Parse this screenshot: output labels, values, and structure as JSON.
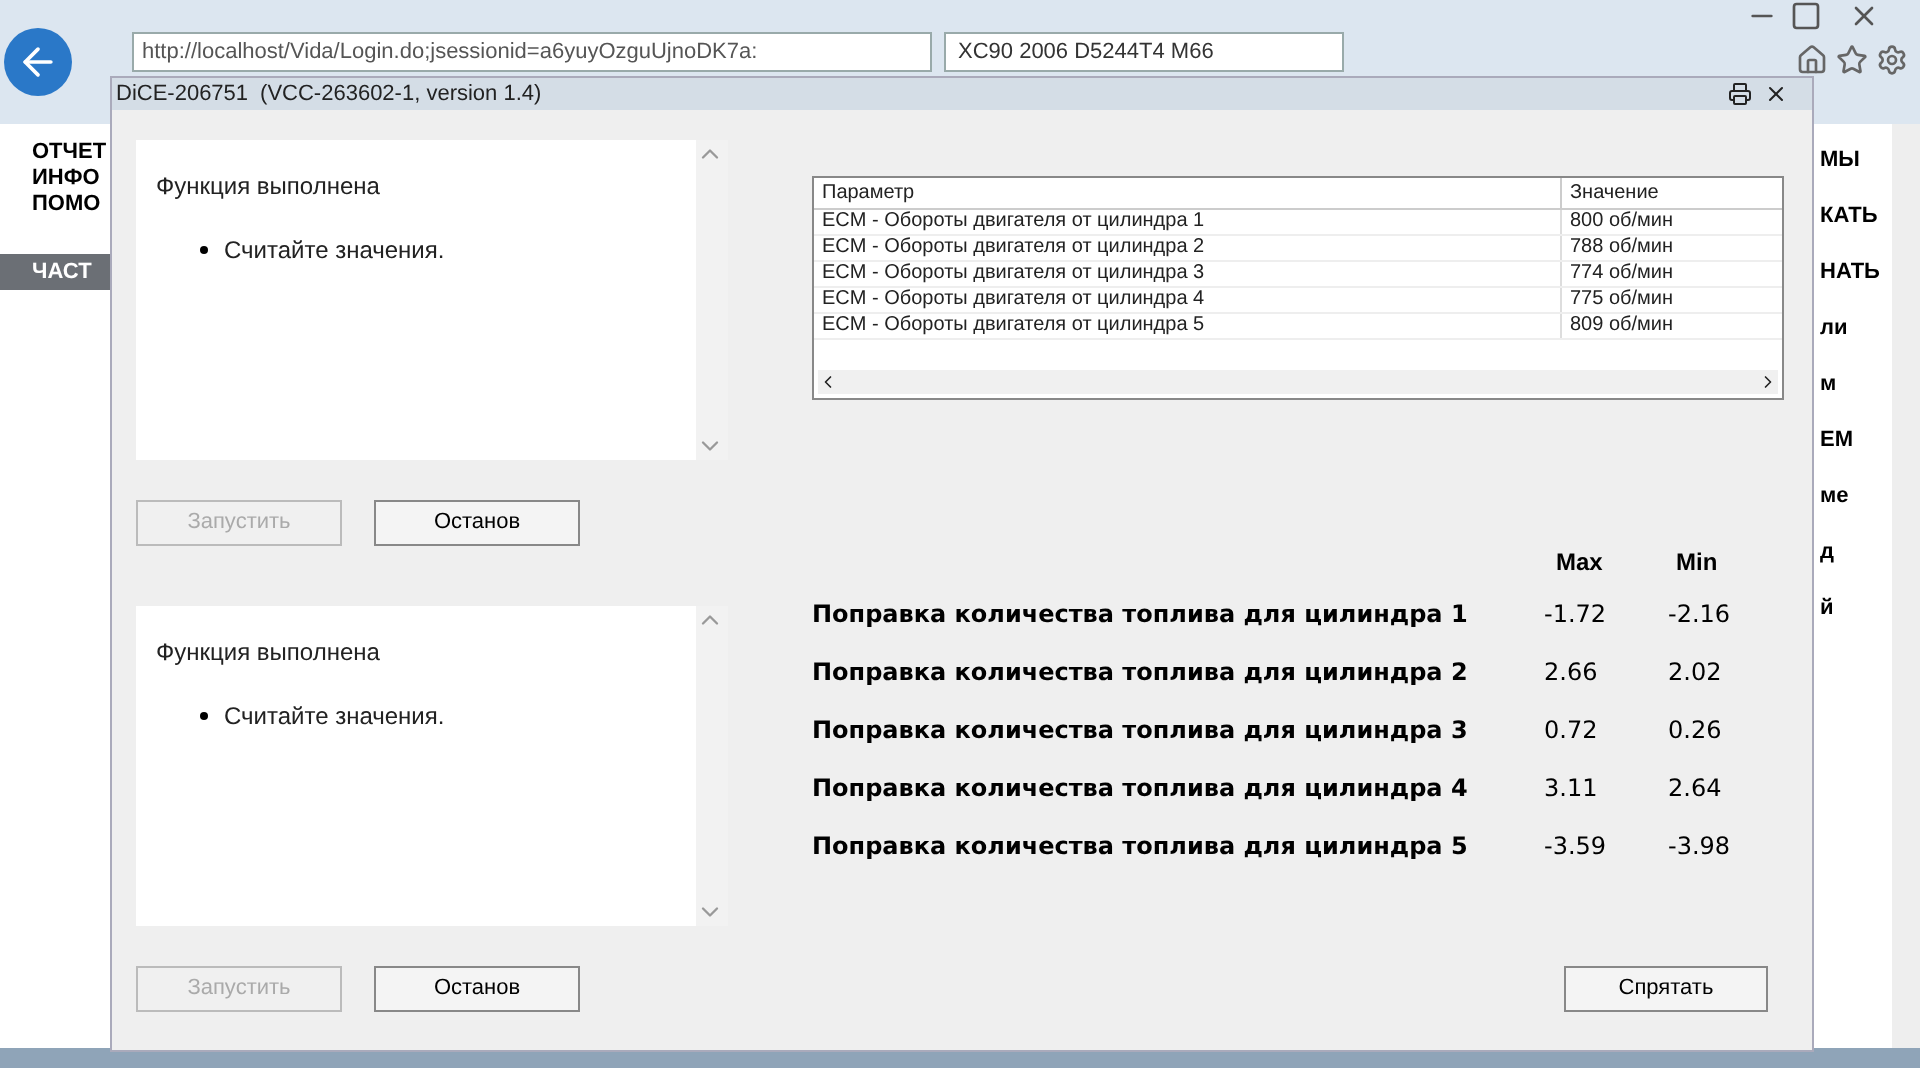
{
  "browser": {
    "address": "http://localhost/Vida/Login.do;jsessionid=a6yuyOzguUjnoDK7a:",
    "tab": "XC90  2006  D5244T4  M66"
  },
  "page": {
    "left_menu": [
      "ОТЧЕТ",
      "ИНФО",
      "ПОМО"
    ],
    "section": "ЧАСТ",
    "right_fragments": [
      "МЫ",
      "КАТЬ",
      "НАТЬ",
      "ли",
      "м",
      "ЕМ",
      "ме",
      "д",
      "й"
    ]
  },
  "dialog": {
    "title": "DiCE-206751",
    "subtitle": "(VCC-263602-1, version 1.4)",
    "panels": [
      {
        "message": "Функция выполнена",
        "bullets": [
          "Считайте значения."
        ],
        "buttons": [
          {
            "label": "Запустить",
            "disabled": true
          },
          {
            "label": "Останов",
            "disabled": false
          }
        ]
      },
      {
        "message": "Функция выполнена",
        "bullets": [
          "Считайте значения."
        ],
        "buttons": [
          {
            "label": "Запустить",
            "disabled": true
          },
          {
            "label": "Останов",
            "disabled": false
          }
        ]
      }
    ],
    "table": {
      "columns": [
        "Параметр",
        "Значение"
      ],
      "rows": [
        [
          "ECM - Обороты двигателя от цилиндра 1",
          "800 об/мин"
        ],
        [
          "ECM - Обороты двигателя от цилиндра 2",
          "788 об/мин"
        ],
        [
          "ECM - Обороты двигателя от цилиндра 3",
          "774 об/мин"
        ],
        [
          "ECM - Обороты двигателя от цилиндра 4",
          "775 об/мин"
        ],
        [
          "ECM - Обороты двигателя от цилиндра 5",
          "809 об/мин"
        ]
      ]
    },
    "results": {
      "columns": [
        "Max",
        "Min"
      ],
      "rows": [
        {
          "label": "Поправка количества топлива для цилиндра 1",
          "max": "-1.72",
          "min": "-2.16"
        },
        {
          "label": "Поправка количества топлива для цилиндра 2",
          "max": "2.66",
          "min": "2.02"
        },
        {
          "label": "Поправка количества топлива для цилиндра 3",
          "max": "0.72",
          "min": "0.26"
        },
        {
          "label": "Поправка количества топлива для цилиндра 4",
          "max": "3.11",
          "min": "2.64"
        },
        {
          "label": "Поправка количества топлива для цилиндра 5",
          "max": "-3.59",
          "min": "-3.98"
        }
      ]
    },
    "hide_button": "Спрятать"
  }
}
